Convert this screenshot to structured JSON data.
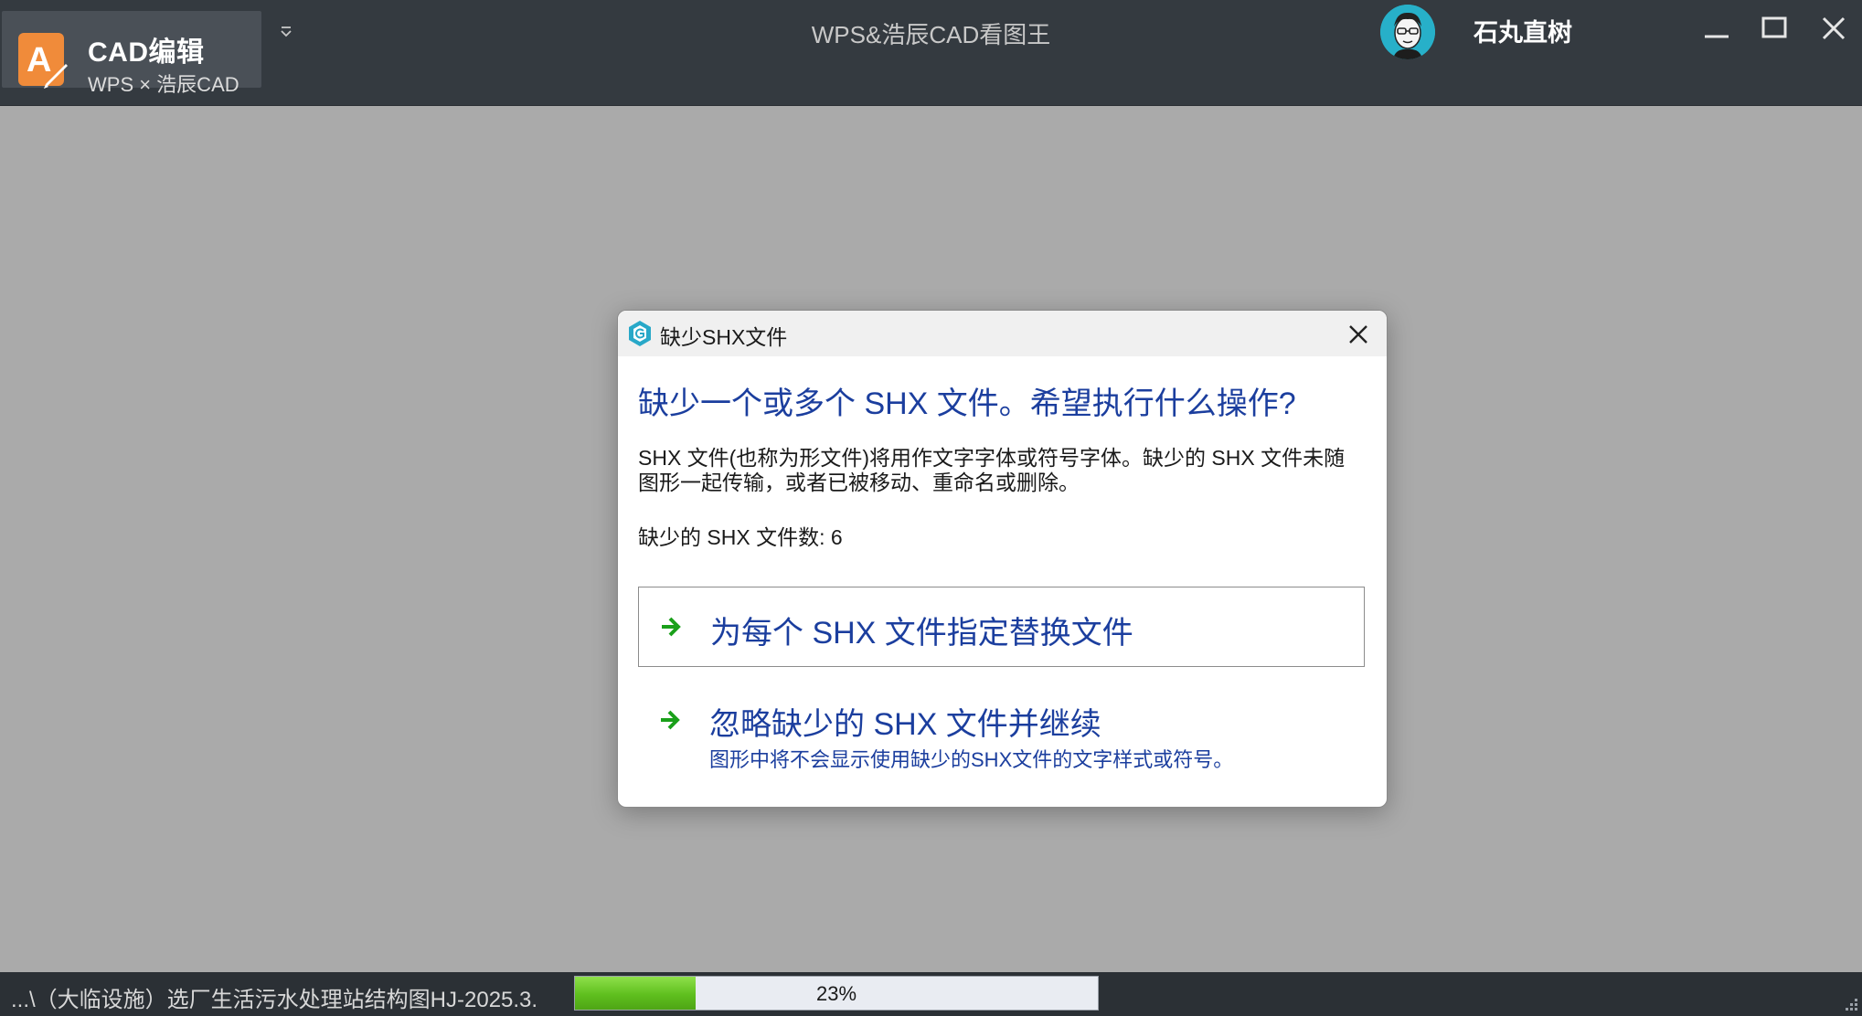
{
  "app": {
    "name": "CAD编辑",
    "subtitle": "WPS × 浩辰CAD",
    "window_title": "WPS&浩辰CAD看图王",
    "username": "石丸直树",
    "brand_color": "#f08b3a"
  },
  "window_controls": {
    "icons": [
      "minimize-icon",
      "maximize-icon",
      "close-icon"
    ]
  },
  "dialog": {
    "title": "缺少SHX文件",
    "heading": "缺少一个或多个 SHX 文件。希望执行什么操作?",
    "description": "SHX 文件(也称为形文件)将用作文字字体或符号字体。缺少的 SHX 文件未随图形一起传输，或者已被移动、重命名或删除。",
    "missing_count_text": "缺少的 SHX 文件数: 6",
    "options": [
      {
        "label": "为每个 SHX 文件指定替换文件",
        "note": ""
      },
      {
        "label": "忽略缺少的 SHX 文件并继续",
        "note": "图形中将不会显示使用缺少的SHX文件的文字样式或符号。"
      }
    ],
    "arrow_color": "#1aa01a",
    "heading_color": "#1b3e9e"
  },
  "status": {
    "file_text": "...\\（大临设施）选厂生活污水处理站结构图HJ-2025.3.",
    "progress_percent": 23,
    "progress_text": "23%"
  }
}
